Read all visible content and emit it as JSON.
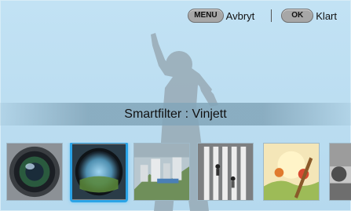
{
  "topbar": {
    "menu_key": "MENU",
    "menu_action": "Avbryt",
    "ok_key": "OK",
    "ok_action": "Klart"
  },
  "filter": {
    "name": "Smartfilter : Vinjett"
  },
  "thumbnails": [
    {
      "icon": "camera-lens-icon",
      "selected": false
    },
    {
      "icon": "vignette-icon",
      "selected": true
    },
    {
      "icon": "miniature-icon",
      "selected": false
    },
    {
      "icon": "crosswalk-icon",
      "selected": false
    },
    {
      "icon": "painting-icon",
      "selected": false
    },
    {
      "icon": "partial-thumbnail-icon",
      "selected": false
    }
  ],
  "colors": {
    "background": "#b9dcf0",
    "selection": "#2aa3e6",
    "pill": "#a7a7a7"
  }
}
